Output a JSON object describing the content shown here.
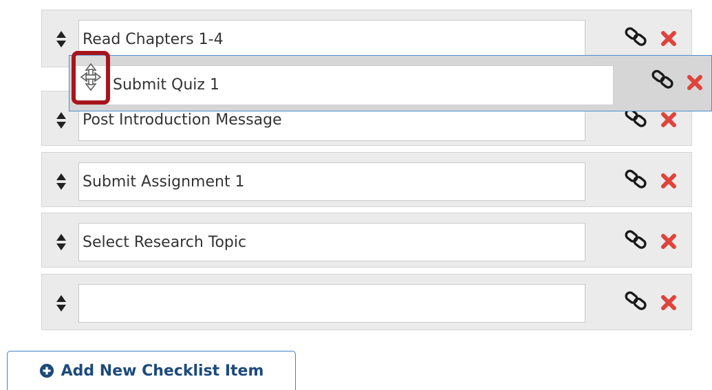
{
  "checklist": {
    "items": [
      {
        "label": "Read Chapters 1-4"
      },
      {
        "label": "Post Introduction Message"
      },
      {
        "label": "Submit Assignment 1"
      },
      {
        "label": "Select Research Topic"
      },
      {
        "label": ""
      }
    ],
    "dragging_item": {
      "label": "Submit Quiz 1"
    },
    "icons": {
      "sort": "sort-arrows-icon",
      "link": "link-icon",
      "delete": "close-icon",
      "move": "move-icon",
      "add": "plus-circle-icon"
    }
  },
  "add_button": {
    "label": "Add New Checklist Item"
  },
  "colors": {
    "delete": "#e0433a",
    "link": "#1a1a1a",
    "highlight": "#a8141c",
    "drag_border": "#4a8fd1",
    "button_text": "#1c4a7b"
  }
}
